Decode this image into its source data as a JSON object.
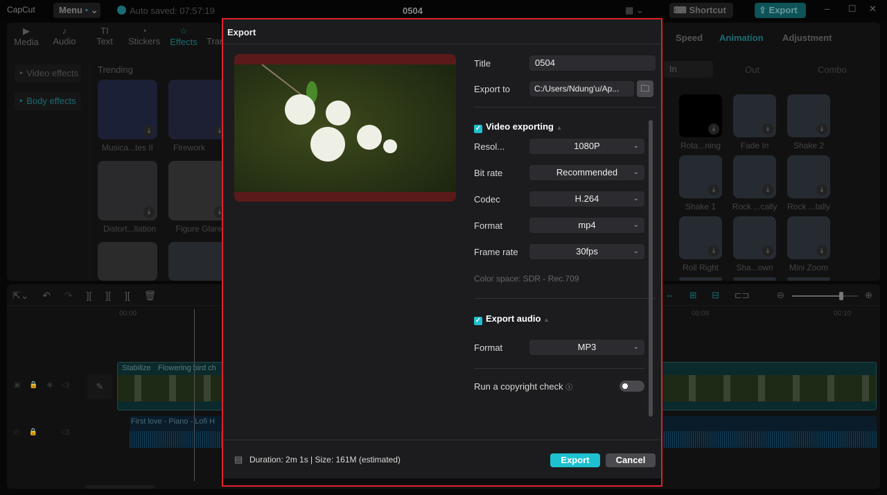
{
  "app": {
    "logo": "CapCut",
    "menu": "Menu",
    "autosave": "Auto saved: 07:57:19",
    "project_title": "0504",
    "shortcut": "Shortcut",
    "export": "Export"
  },
  "media_tabs": [
    {
      "label": "Media",
      "icon": "media-icon"
    },
    {
      "label": "Audio",
      "icon": "audio-icon"
    },
    {
      "label": "Text",
      "icon": "text-icon"
    },
    {
      "label": "Stickers",
      "icon": "sticker-icon"
    },
    {
      "label": "Effects",
      "icon": "effects-icon"
    },
    {
      "label": "Tran",
      "icon": "transition-icon"
    }
  ],
  "effects_sidebar": [
    "Video effects",
    "Body effects"
  ],
  "trending": {
    "heading": "Trending",
    "items": [
      "Musica...tes II",
      "Firework",
      "Distort...llation",
      "Figure Glare"
    ]
  },
  "right_panel": {
    "tabs": [
      "Speed",
      "Animation",
      "Adjustment"
    ],
    "subtabs": [
      "In",
      "Out",
      "Combo"
    ],
    "items": [
      "Rota...ning",
      "Fade In",
      "Shake 2",
      "Shake 1",
      "Rock ...cally",
      "Rock ...tally",
      "Roll Right",
      "Sha...own",
      "Mini Zoom"
    ]
  },
  "timeline": {
    "ruler": [
      "00:00",
      "00:08",
      "00:10"
    ],
    "video_clip": {
      "tag": "Stabilize",
      "name": "Flowering bird ch"
    },
    "audio_clip": "First love - Piano - Lofi H",
    "zoom_level": 0.75
  },
  "dialog": {
    "title": "Export",
    "title_label": "Title",
    "title_value": "0504",
    "export_to_label": "Export to",
    "export_to_value": "C:/Users/Ndung'u/Ap...",
    "video_section": "Video exporting",
    "video_fields": [
      {
        "label": "Resol...",
        "value": "1080P"
      },
      {
        "label": "Bit rate",
        "value": "Recommended"
      },
      {
        "label": "Codec",
        "value": "H.264"
      },
      {
        "label": "Format",
        "value": "mp4"
      },
      {
        "label": "Frame rate",
        "value": "30fps"
      }
    ],
    "color_space": "Color space: SDR - Rec.709",
    "audio_section": "Export audio",
    "audio_fields": [
      {
        "label": "Format",
        "value": "MP3"
      }
    ],
    "copyright": "Run a copyright check",
    "copyright_enabled": false,
    "footer_info": "Duration: 2m 1s | Size: 161M (estimated)",
    "export_btn": "Export",
    "cancel_btn": "Cancel"
  },
  "colors": {
    "accent": "#1ec1d0",
    "highlight_border": "#e0212a"
  }
}
